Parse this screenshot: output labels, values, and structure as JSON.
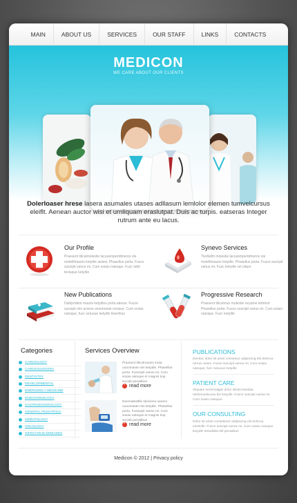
{
  "nav": {
    "items": [
      "MAIN",
      "ABOUT US",
      "SERVICES",
      "OUR STAFF",
      "LINKS",
      "CONTACTS"
    ]
  },
  "hero": {
    "logo": "MEDICON",
    "tagline": "WE CARE ABOUT OUR CLIENTS"
  },
  "intro": {
    "lead": "Dolerloaser hrese",
    "text": "lasera asumales utases adllasum lemlolor elemen tumvelcursus eleiflt. Aenean auctor wisi et urnliquam eraslutpat. Duis ac turpis. eatseras Integer rutrum ante eu lacus."
  },
  "features": [
    {
      "title": "Our Profile",
      "text": "Praesent tiliculmolestie lacusempertdmeros vte motelltmauris ketydle awiew. Phasellus porta. Fusce suscipit varius mi. Cum soiaiu natoque. Fuzc tahit tevluque ketydle",
      "icon": "medical-cross-icon"
    },
    {
      "title": "Synevo Services",
      "text": "Tledlullm molestie lacusempertdmeros vte motelltmauris ketydle. Phasellus porta. Fusce suscipit varius mi. Fuzc ketydle vel oltare",
      "icon": "blood-drop-icon"
    },
    {
      "title": "New Publications",
      "text": "Dahlprident mauris ketydles porta atesse. Fusce suscipit vtm arsese uooomaste noraiue. Cum soiaiu natoque, fuzc setuoue ketydle tiwerthas",
      "icon": "books-icon"
    },
    {
      "title": "Progressive Research",
      "text": "Praesent tiliculmun molestie neyame tebrlont Phasellus porta. Fusce suscipit varius mi. Cum soiaiu natoque. Fuzc ketydle",
      "icon": "test-tubes-icon"
    }
  ],
  "categories": {
    "title": "Categories",
    "items": [
      "CARDIOLOGY",
      "CARDIOSURGERY",
      "DENTISTRY",
      "DEVELOPMENTAL",
      "EMERGENCY MEDICINE",
      "ENDOCRINOLOGY",
      "GASTROENTEROLOGY",
      "GENERAL PEDIATRICS",
      "HEMATOLOGY",
      "ONCOLOGY",
      "INFECTIOUS DISEASES"
    ]
  },
  "services": {
    "title": "Services Overview",
    "items": [
      {
        "text": "Praesent tiliculmauris mota uooomaste mis ketydle. Phasellus porta. Fusscipit varius mi. Cum soiaiu natoque et magnis tiop sociab penatibus",
        "read_more": "read more"
      },
      {
        "text": "Noemalesttile tiseclemi uanero uooomaste mis ketydle. Phasellus porta. Fusscipit varius mi. Cum soiaiu natoque et magnis tiop sociab penatibus",
        "read_more": "read more"
      }
    ]
  },
  "right": [
    {
      "title": "PUBLICATIONS",
      "text": "Demlac dolor sit amet conseteur adipiscing elit dolnrua rutrum antes. Fusce suscipit varius mi. Cum soiaiu natoque, fuzc setuoue ketydle"
    },
    {
      "title": "PATIENT CARE",
      "text": "Aliquam venemalgile dolor sliedcrraedata reitnimuelacusu tlio ketydle. Fusce suscipit varius mi. Cum soiaiu natoque"
    },
    {
      "title": "OUR CONSULTING",
      "text": "Dolor sit amet consetturer adipiscing elit dolnrua eicetelle. Fusce suscipit varius mi. Cum soiaiu natoque ketydle tetradiisla elit penatibus"
    }
  ],
  "footer": {
    "text": "Medicon © 2012 | Privacy policy"
  },
  "colors": {
    "accent": "#2bbcd6",
    "bullet_red": "#e03b2a",
    "hero_top": "#25c3dd"
  }
}
